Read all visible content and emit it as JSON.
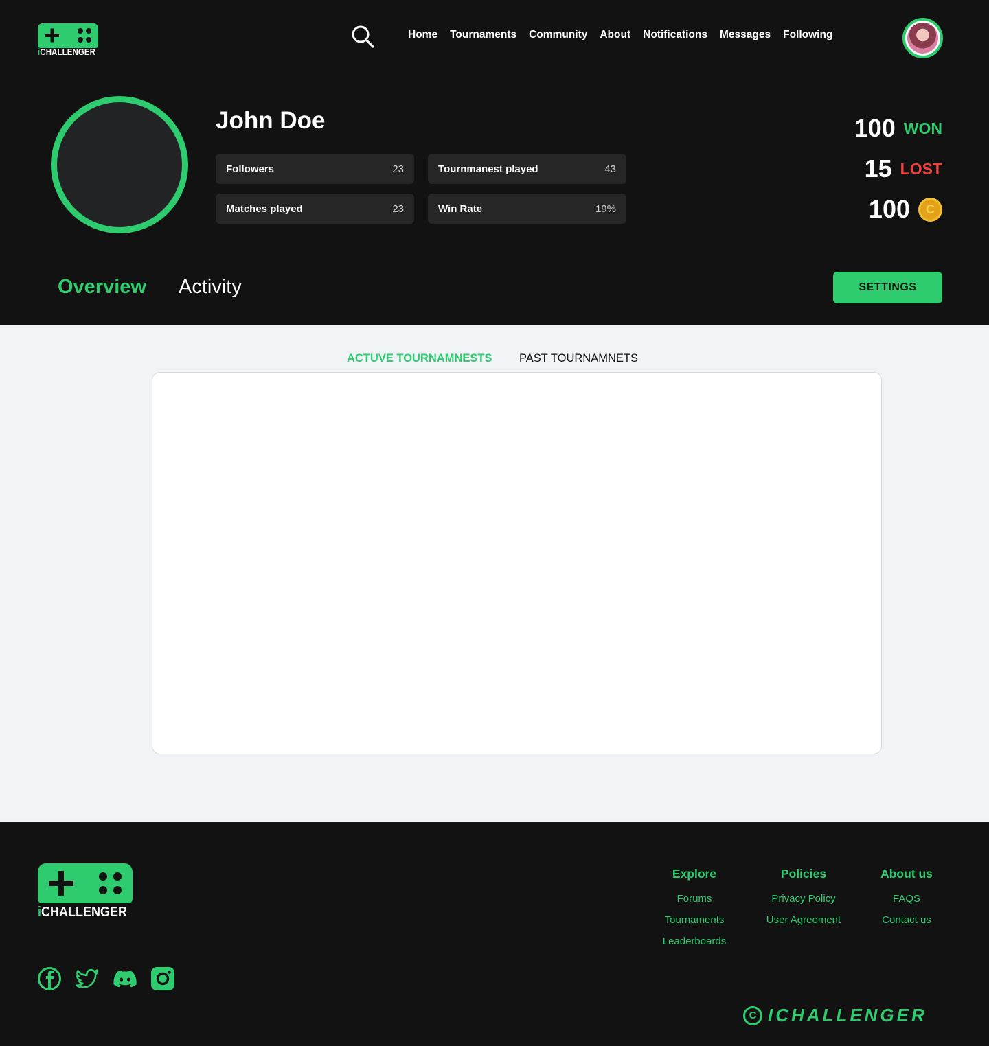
{
  "brand": {
    "name_prefix": "i",
    "name_rest": "CHALLENGER"
  },
  "nav": {
    "items": [
      "Home",
      "Tournaments",
      "Community",
      "About",
      "Notifications",
      "Messages",
      "Following"
    ]
  },
  "profile": {
    "name": "John Doe",
    "stats": [
      {
        "label": "Followers",
        "value": "23"
      },
      {
        "label": "Tournmanest played",
        "value": "43"
      },
      {
        "label": "Matches played",
        "value": "23"
      },
      {
        "label": "Win Rate",
        "value": "19%"
      }
    ],
    "won": {
      "value": "100",
      "label": "WON"
    },
    "lost": {
      "value": "15",
      "label": "LOST"
    },
    "coins": {
      "value": "100",
      "symbol": "C"
    }
  },
  "tabs": {
    "overview": "Overview",
    "activity": "Activity",
    "active": "overview"
  },
  "settings_button": "SETTINGS",
  "tournament_tabs": {
    "active": "ACTUVE TOURNAMNESTS",
    "past": "PAST TOURNAMNETS"
  },
  "footer": {
    "columns": [
      {
        "title": "Explore",
        "links": [
          "Forums",
          "Tournaments",
          "Leaderboards"
        ]
      },
      {
        "title": "Policies",
        "links": [
          "Privacy Policy",
          "User Agreement"
        ]
      },
      {
        "title": "About us",
        "links": [
          "FAQS",
          "Contact us"
        ]
      }
    ],
    "social_icons": [
      "facebook-icon",
      "twitter-icon",
      "discord-icon",
      "instagram-icon"
    ],
    "copyright_symbol": "C",
    "copyright_text": "ICHALLENGER"
  },
  "colors": {
    "accent": "#2ecc6e",
    "lost": "#f2413a",
    "dark_bg": "#121212",
    "card_bg": "#262626",
    "coin": "#e3a21a"
  }
}
